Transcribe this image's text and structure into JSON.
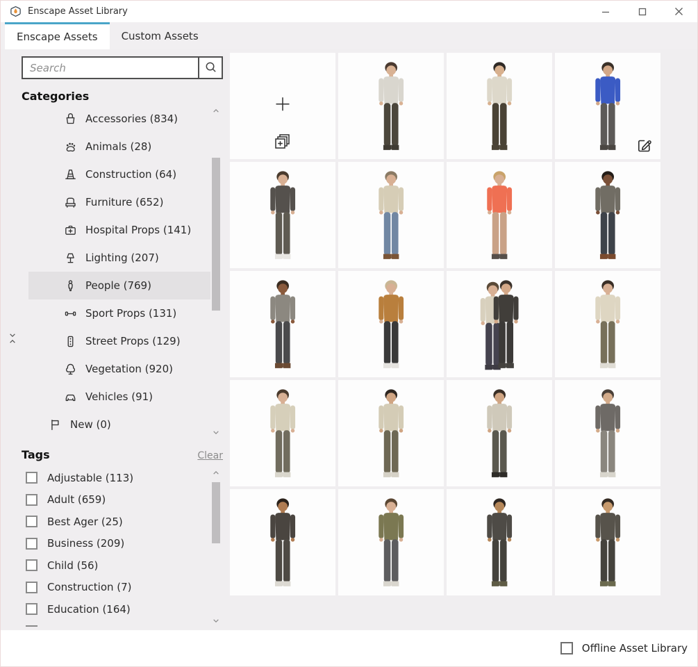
{
  "window": {
    "title": "Enscape Asset Library"
  },
  "tabs": [
    {
      "label": "Enscape Assets",
      "active": true
    },
    {
      "label": "Custom Assets",
      "active": false
    }
  ],
  "sidebar": {
    "search": {
      "placeholder": "Search",
      "value": "",
      "button_icon": "search-icon"
    },
    "categories": {
      "header": "Categories",
      "items": [
        {
          "label": "Accessories (834)",
          "icon": "bag-icon",
          "selected": false
        },
        {
          "label": "Animals (28)",
          "icon": "paw-icon",
          "selected": false
        },
        {
          "label": "Construction (64)",
          "icon": "cone-icon",
          "selected": false
        },
        {
          "label": "Furniture (652)",
          "icon": "armchair-icon",
          "selected": false
        },
        {
          "label": "Hospital Props (141)",
          "icon": "first-aid-icon",
          "selected": false
        },
        {
          "label": "Lighting (207)",
          "icon": "lamp-icon",
          "selected": false
        },
        {
          "label": "People (769)",
          "icon": "person-icon",
          "selected": true
        },
        {
          "label": "Sport Props (131)",
          "icon": "dumbbell-icon",
          "selected": false
        },
        {
          "label": "Street Props (129)",
          "icon": "traffic-light-icon",
          "selected": false
        },
        {
          "label": "Vegetation (920)",
          "icon": "tree-icon",
          "selected": false
        },
        {
          "label": "Vehicles (91)",
          "icon": "car-icon",
          "selected": false
        },
        {
          "label": "New (0)",
          "icon": "flag-icon",
          "selected": false,
          "top_level": true
        }
      ]
    },
    "tags": {
      "header": "Tags",
      "clear_label": "Clear",
      "items": [
        {
          "label": "Adjustable (113)",
          "checked": false
        },
        {
          "label": "Adult (659)",
          "checked": false
        },
        {
          "label": "Best Ager (25)",
          "checked": false
        },
        {
          "label": "Business (209)",
          "checked": false
        },
        {
          "label": "Child (56)",
          "checked": false
        },
        {
          "label": "Construction (7)",
          "checked": false
        },
        {
          "label": "Education (164)",
          "checked": false
        }
      ],
      "partial_next_item_visible": true
    }
  },
  "grid": {
    "items": [
      {
        "type": "add",
        "desc": "add custom asset tile",
        "icons": [
          "plus-icon",
          "add-collection-icon"
        ]
      },
      {
        "type": "person",
        "desc": "man in light sweater and dark pants, hands at sides",
        "colors": {
          "hair": "#4a3a30",
          "skin": "#d9b294",
          "top": "#d9d6ce",
          "bottom": "#4c473c",
          "shoes": "#3f3b33"
        }
      },
      {
        "type": "person",
        "desc": "man with glasses in cream sweater and dark olive pants",
        "colors": {
          "hair": "#2f2a26",
          "skin": "#d8b18f",
          "top": "#ddd8ca",
          "bottom": "#4a4336",
          "shoes": "#4a4336"
        }
      },
      {
        "type": "person",
        "desc": "woman in blue blazer, hand on hip",
        "edit_icon": true,
        "colors": {
          "hair": "#3a3028",
          "skin": "#d3a888",
          "top": "#3b5bc4",
          "bottom": "#5d5a58",
          "shoes": "#4a4642"
        }
      },
      {
        "type": "person",
        "desc": "bearded man in long dark coat and white sneakers",
        "colors": {
          "hair": "#4a3b2e",
          "skin": "#d8b094",
          "top": "#55514d",
          "bottom": "#5f5b52",
          "shoes": "#e8e6e2"
        }
      },
      {
        "type": "person",
        "desc": "man with backpack in cream sweater and blue jeans walking",
        "colors": {
          "hair": "#8a7a64",
          "skin": "#d8b094",
          "top": "#d6cdb6",
          "bottom": "#7187a3",
          "shoes": "#7a5436"
        }
      },
      {
        "type": "person",
        "desc": "blonde woman in coral coat with arms crossed",
        "colors": {
          "hair": "#c9a36a",
          "skin": "#d8b094",
          "top": "#ef7053",
          "bottom": "#c9a287",
          "shoes": "#564f4a"
        }
      },
      {
        "type": "person",
        "desc": "man in gray vest over light sweater, hands in pockets",
        "colors": {
          "hair": "#241d18",
          "skin": "#7a5038",
          "top": "#716d64",
          "bottom": "#3e434a",
          "shoes": "#7a4a2e"
        }
      },
      {
        "type": "person",
        "desc": "man in vest gesturing while talking",
        "colors": {
          "hair": "#3a2c20",
          "skin": "#8a5a3c",
          "top": "#8c8880",
          "bottom": "#4a4a4c",
          "shoes": "#6b4a33"
        }
      },
      {
        "type": "person",
        "desc": "large person in camel jacket and beanie walking",
        "colors": {
          "hair": "#c9b694",
          "skin": "#d8b094",
          "top": "#b97f3d",
          "bottom": "#3a3a3a",
          "shoes": "#e5e3df"
        }
      },
      {
        "type": "couple",
        "desc": "two people hugging",
        "colors": {
          "hair": "#3a312a",
          "skin": "#d3a888",
          "top": "#413e3a",
          "bottom": "#3c3a38",
          "shoes": "#44423e"
        },
        "colors2": {
          "hair": "#5a4a38",
          "skin": "#d8b094",
          "top": "#d8d0bd",
          "bottom": "#45434f",
          "shoes": "#3e3c44"
        }
      },
      {
        "type": "person",
        "desc": "man in cream long-sleeve and olive pants walking",
        "colors": {
          "hair": "#3a2f26",
          "skin": "#d8b094",
          "top": "#ded6c2",
          "bottom": "#77705a",
          "shoes": "#dfdcd4"
        }
      },
      {
        "type": "person",
        "desc": "man seated gesturing with both hands",
        "colors": {
          "hair": "#4a3a2c",
          "skin": "#d8b094",
          "top": "#d6cfba",
          "bottom": "#716c5e",
          "shoes": "#d9d6cc"
        }
      },
      {
        "type": "person",
        "desc": "man in beige sweater standing with hands in pockets",
        "colors": {
          "hair": "#2e2620",
          "skin": "#d0a583",
          "top": "#d4ccb6",
          "bottom": "#6e6854",
          "shoes": "#d5d1c6"
        }
      },
      {
        "type": "person",
        "desc": "man carrying jacket bag over shoulder",
        "colors": {
          "hair": "#3a2f26",
          "skin": "#d0a583",
          "top": "#cfc9ba",
          "bottom": "#5b594f",
          "shoes": "#2e2c28"
        }
      },
      {
        "type": "person",
        "desc": "bearded man in gray coat walking",
        "colors": {
          "hair": "#4a4038",
          "skin": "#d3ab8a",
          "top": "#6e6a66",
          "bottom": "#8a867e",
          "shoes": "#d8d5cc"
        }
      },
      {
        "type": "person",
        "desc": "man with turban and beard in dark coat gesturing",
        "colors": {
          "hair": "#2a211a",
          "skin": "#b07c52",
          "top": "#4a4540",
          "bottom": "#4e4a44",
          "shoes": "#dcd9d2"
        }
      },
      {
        "type": "person",
        "desc": "man in olive green jacket with hands in pockets",
        "colors": {
          "hair": "#5a4632",
          "skin": "#d8b094",
          "top": "#7b7852",
          "bottom": "#5d5d5f",
          "shoes": "#d9d6ce"
        }
      },
      {
        "type": "person",
        "desc": "man with glasses and beanie in dark jacket, side view",
        "colors": {
          "hair": "#2c2520",
          "skin": "#b58759",
          "top": "#4e4b46",
          "bottom": "#44423c",
          "shoes": "#5f5c46"
        }
      },
      {
        "type": "person",
        "desc": "man with beanie in open dark jacket, arms out",
        "colors": {
          "hair": "#332a22",
          "skin": "#c79a6d",
          "top": "#57534b",
          "bottom": "#45433d",
          "shoes": "#6b6a4e"
        }
      }
    ]
  },
  "footer": {
    "offline_label": "Offline Asset Library",
    "checked": false
  },
  "colors": {
    "accent_blue": "#4aa5c8",
    "content_bg": "#f0eef0",
    "selected_row_bg": "#e3e1e3",
    "logo_flame": "#e8923a"
  }
}
